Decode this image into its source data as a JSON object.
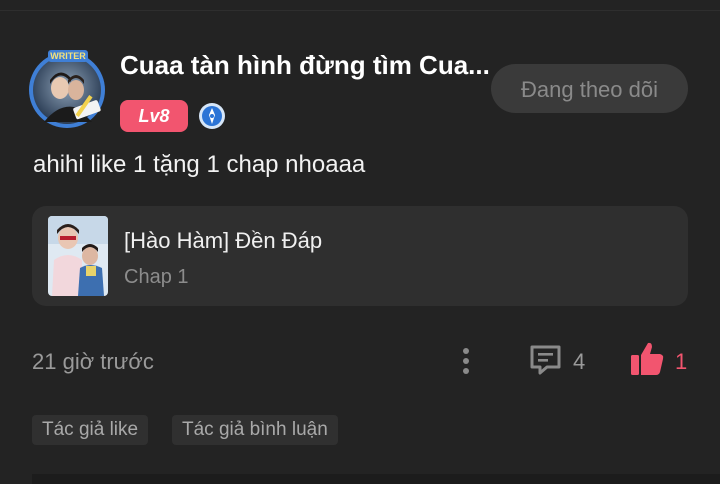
{
  "comment": {
    "avatar_badge": "WRITER",
    "username": "Cuaa tàn hình đừng tìm Cua...",
    "level": "Lv8",
    "follow_button_label": "Đang theo dõi",
    "text": "ahihi like 1 tặng 1 chap nhoaaa",
    "chapter": {
      "title": "[Hào Hàm] Đền Đáp",
      "subtitle": "Chap 1"
    },
    "timestamp": "21 giờ trước",
    "reply_count": "4",
    "like_count": "1",
    "tags": [
      "Tác giả like",
      "Tác giả bình luận"
    ]
  },
  "colors": {
    "background": "#232323",
    "accent": "#f2556f",
    "card": "#2f2f2f",
    "muted_text": "#9a9a9a"
  },
  "icons": [
    "avatar-frame",
    "verified-icon",
    "more-vertical-icon",
    "comment-icon",
    "thumbs-up-icon"
  ]
}
